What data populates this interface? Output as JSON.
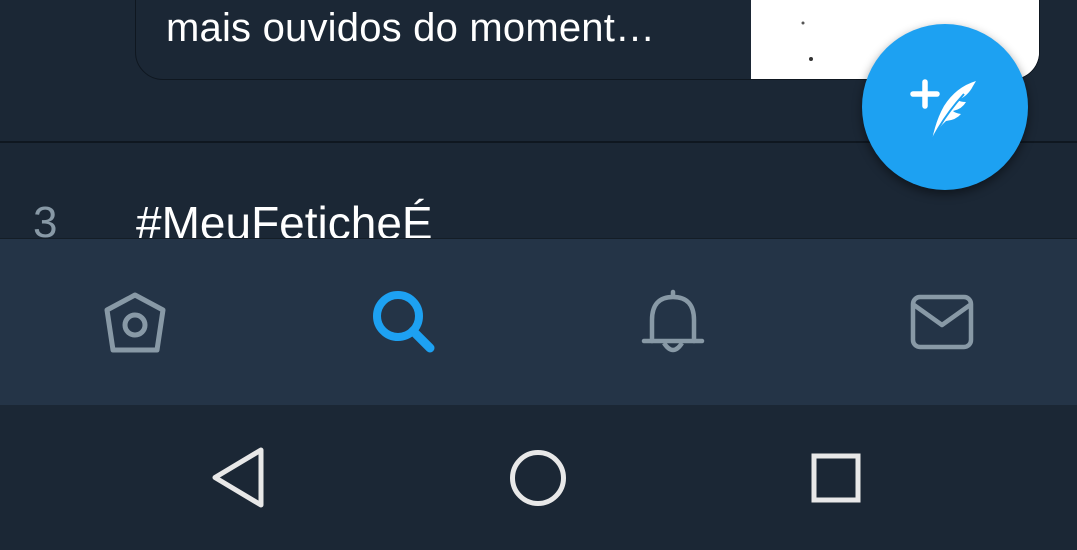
{
  "feed": {
    "card_text": "mais ouvidos do moment…",
    "trend": {
      "rank": "3",
      "hashtag": "#MeuFeticheÉ"
    }
  },
  "fab": {
    "icon": "compose-tweet-icon",
    "color": "#1da1f2"
  },
  "tabbar": {
    "items": [
      {
        "icon": "home-icon",
        "active": false
      },
      {
        "icon": "search-icon",
        "active": true
      },
      {
        "icon": "notifications-bell-icon",
        "active": false
      },
      {
        "icon": "messages-envelope-icon",
        "active": false
      }
    ],
    "active_color": "#1da1f2",
    "inactive_color": "#8899a6"
  },
  "system_nav": {
    "items": [
      {
        "icon": "back-triangle-icon"
      },
      {
        "icon": "home-circle-icon"
      },
      {
        "icon": "recents-square-icon"
      }
    ]
  }
}
